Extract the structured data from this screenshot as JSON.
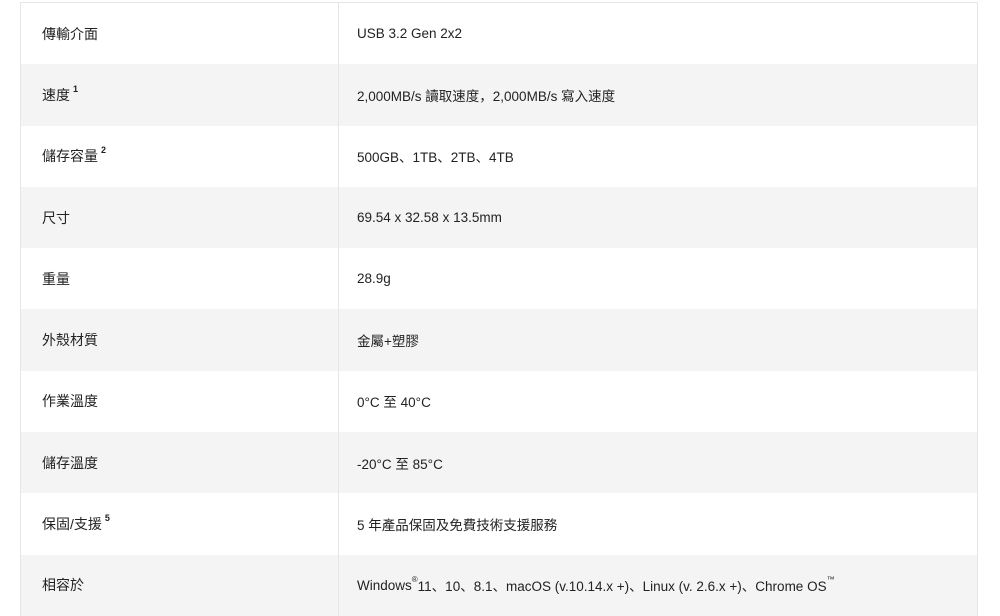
{
  "spec_table": {
    "rows": [
      {
        "label": "傳輸介面",
        "sup": "",
        "value": "USB 3.2 Gen 2x2"
      },
      {
        "label": "速度",
        "sup": "1",
        "value": "2,000MB/s 讀取速度，2,000MB/s 寫入速度"
      },
      {
        "label": "儲存容量",
        "sup": "2",
        "value": "500GB、1TB、2TB、4TB"
      },
      {
        "label": "尺寸",
        "sup": "",
        "value": "69.54 x 32.58 x 13.5mm"
      },
      {
        "label": "重量",
        "sup": "",
        "value": "28.9g"
      },
      {
        "label": "外殼材質",
        "sup": "",
        "value": "金屬+塑膠"
      },
      {
        "label": "作業溫度",
        "sup": "",
        "value": "0°C 至 40°C"
      },
      {
        "label": "儲存溫度",
        "sup": "",
        "value": "-20°C 至 85°C"
      },
      {
        "label": "保固/支援",
        "sup": "5",
        "value": "5 年產品保固及免費技術支援服務"
      },
      {
        "label": "相容於",
        "sup": "",
        "value_parts": {
          "windows": "Windows",
          "reg": "®",
          "rest": " 11、10、8.1、macOS (v.10.14.x +)、Linux (v. 2.6.x +)、Chrome OS",
          "tm": "™"
        }
      }
    ]
  },
  "colors": {
    "row_shaded": "#f4f4f4",
    "row_plain": "#ffffff",
    "border": "#e6e6e6",
    "text": "#222222"
  }
}
